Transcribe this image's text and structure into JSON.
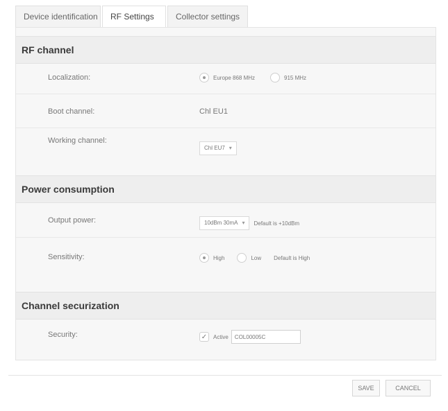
{
  "tabs": [
    {
      "label": "Device identification"
    },
    {
      "label": "RF Settings"
    },
    {
      "label": "Collector settings"
    }
  ],
  "sections": {
    "rf_channel": {
      "title": "RF channel",
      "localization": {
        "label": "Localization:",
        "options": [
          {
            "label": "Europe 868 MHz",
            "selected": true
          },
          {
            "label": "915 MHz",
            "selected": false
          }
        ]
      },
      "boot_channel": {
        "label": "Boot channel:",
        "value": "Chl EU1"
      },
      "working_channel": {
        "label": "Working channel:",
        "selected": "Chl EU7"
      }
    },
    "power": {
      "title": "Power consumption",
      "output_power": {
        "label": "Output power:",
        "selected": "10dBm 30mA",
        "note": "Default is +10dBm"
      },
      "sensitivity": {
        "label": "Sensitivity:",
        "options": [
          {
            "label": "High",
            "selected": true
          },
          {
            "label": "Low",
            "selected": false
          }
        ],
        "note": "Default is High"
      }
    },
    "securization": {
      "title": "Channel securization",
      "security": {
        "label": "Security:",
        "checkbox_label": "Active",
        "checked": true,
        "value": "COL00005C"
      }
    }
  },
  "footer": {
    "save_label": "SAVE",
    "cancel_label": "CANCEL"
  }
}
